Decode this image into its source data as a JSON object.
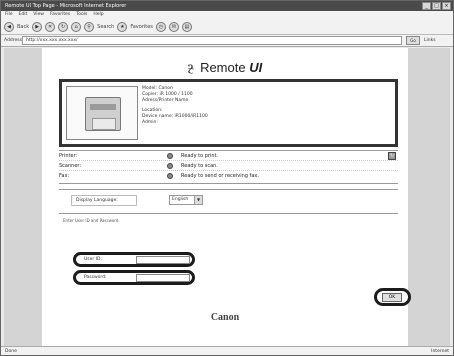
{
  "window": {
    "title": "Remote UI Top Page - Microsoft Internet Explorer",
    "controls": [
      "_",
      "□",
      "×"
    ]
  },
  "menu": [
    "File",
    "Edit",
    "View",
    "Favorites",
    "Tools",
    "Help"
  ],
  "toolbar": {
    "back_label": "Back",
    "search_label": "Search",
    "favorites_label": "Favorites"
  },
  "address": {
    "label": "Address",
    "value": "http://xxx.xxx.xxx.xxx/",
    "go_label": "Go",
    "links_label": "Links"
  },
  "logo": {
    "text_main": "Remote ",
    "text_bold": "UI"
  },
  "device": {
    "info_lines": [
      "Model: Canon",
      "Copier: iR 1000 / 1100",
      "Adress/Printer Name",
      "",
      "Location:",
      "Device name: iR1000/iR1100",
      "Admin:"
    ]
  },
  "status": {
    "rows": [
      {
        "label": "Printer:",
        "text": "Ready to print."
      },
      {
        "label": "Scanner:",
        "text": "Ready to scan."
      },
      {
        "label": "Fax:",
        "text": "Ready to send or receiving fax."
      }
    ]
  },
  "language": {
    "label": "Display Language:",
    "value": "English"
  },
  "login": {
    "hint": "Enter User ID and Password.",
    "user_label": "User ID:",
    "password_label": "Password:",
    "ok_label": "OK"
  },
  "brand": "Canon",
  "statusbar": {
    "left": "Done",
    "right": "Internet"
  }
}
